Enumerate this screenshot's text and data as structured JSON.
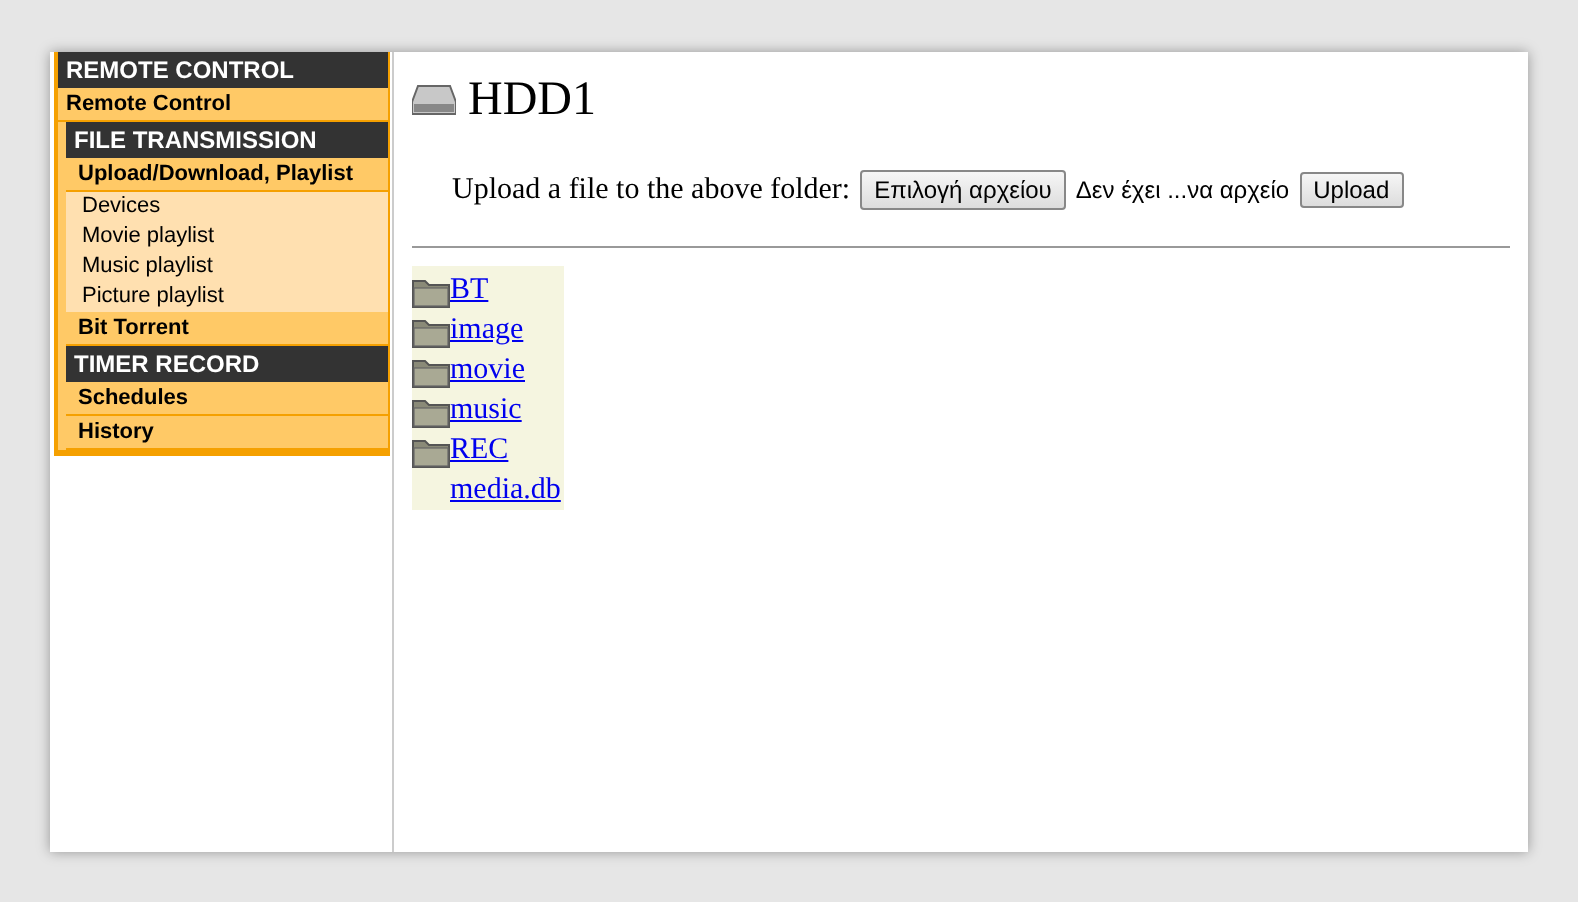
{
  "sidebar": {
    "sections": [
      {
        "title": "REMOTE CONTROL",
        "indent": false,
        "items": [
          {
            "label": "Remote Control",
            "kind": "item"
          }
        ]
      },
      {
        "title": "FILE TRANSMISSION",
        "indent": true,
        "items": [
          {
            "label": "Upload/Download, Playlist",
            "kind": "item"
          },
          {
            "label": "Devices",
            "kind": "subitem"
          },
          {
            "label": "Movie playlist",
            "kind": "subitem"
          },
          {
            "label": "Music playlist",
            "kind": "subitem"
          },
          {
            "label": "Picture playlist",
            "kind": "subitem"
          },
          {
            "label": "Bit Torrent",
            "kind": "item"
          }
        ]
      },
      {
        "title": "TIMER RECORD",
        "indent": true,
        "items": [
          {
            "label": "Schedules",
            "kind": "item"
          },
          {
            "label": "History",
            "kind": "item"
          }
        ]
      }
    ]
  },
  "heading": "HDD1",
  "upload": {
    "label": "Upload a file to the above folder:",
    "choose_button": "Επιλογή αρχείου",
    "file_status": "Δεν έχει ...να αρχείο",
    "upload_button": "Upload"
  },
  "files": [
    {
      "name": "BT",
      "kind": "folder"
    },
    {
      "name": "image",
      "kind": "folder"
    },
    {
      "name": "movie",
      "kind": "folder"
    },
    {
      "name": "music",
      "kind": "folder"
    },
    {
      "name": "REC",
      "kind": "folder"
    },
    {
      "name": "media.db",
      "kind": "file"
    }
  ]
}
